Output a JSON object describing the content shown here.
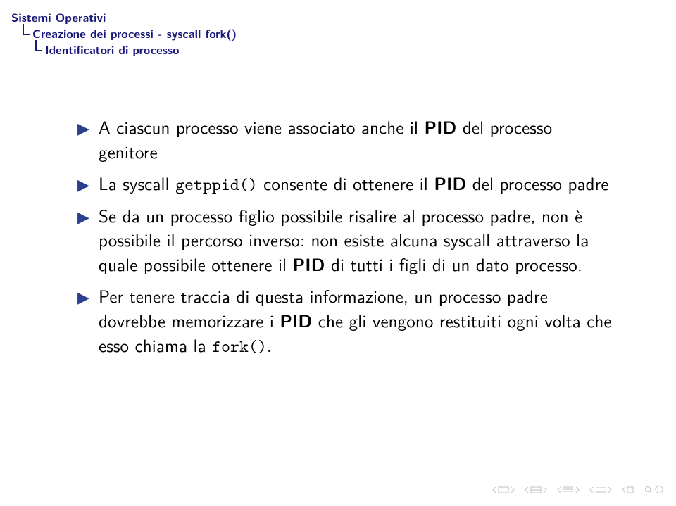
{
  "breadcrumb": {
    "level1": "Sistemi Operativi",
    "level2": "Creazione dei processi - syscall fork()",
    "level3": "Identificatori di processo"
  },
  "bullets": [
    {
      "segments": [
        {
          "t": "A ciascun processo viene associato anche il "
        },
        {
          "t": "PID",
          "bold": true
        },
        {
          "t": " del processo genitore"
        }
      ]
    },
    {
      "segments": [
        {
          "t": "La syscall "
        },
        {
          "t": "getppid()",
          "tt": true
        },
        {
          "t": " consente di ottenere il "
        },
        {
          "t": "PID",
          "bold": true
        },
        {
          "t": " del processo padre"
        }
      ]
    },
    {
      "segments": [
        {
          "t": "Se da un processo figlio possibile risalire al processo padre, non è possibile il percorso inverso: non esiste alcuna syscall attraverso la quale possibile ottenere il "
        },
        {
          "t": "PID",
          "bold": true
        },
        {
          "t": " di tutti i figli di un dato processo."
        }
      ]
    },
    {
      "segments": [
        {
          "t": "Per tenere traccia di questa informazione, un processo padre dovrebbe memorizzare i "
        },
        {
          "t": "PID",
          "bold": true
        },
        {
          "t": " che gli vengono restituiti ogni volta che esso chiama la "
        },
        {
          "t": "fork()",
          "tt": true
        },
        {
          "t": "."
        }
      ]
    }
  ]
}
